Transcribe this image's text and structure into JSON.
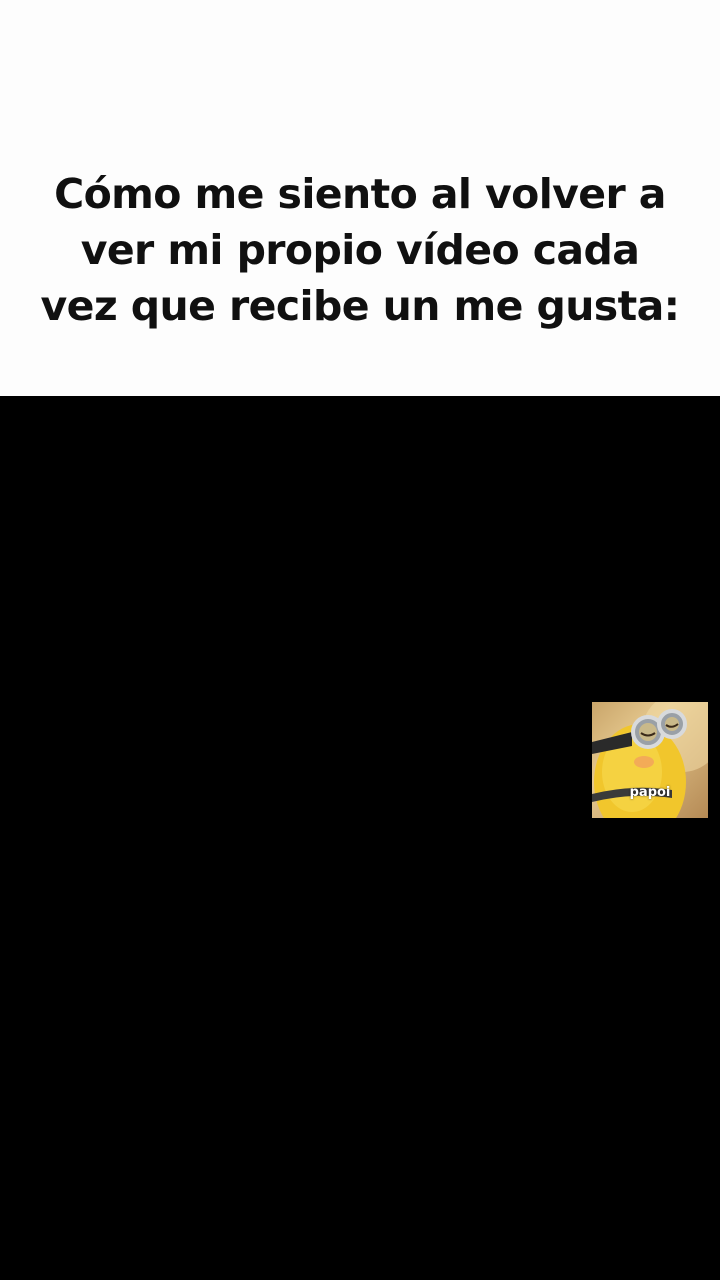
{
  "caption": {
    "text": "Cómo me siento al volver a ver mi propio vídeo cada vez que recibe un me gusta:"
  },
  "sticker": {
    "label": "papoi",
    "icon": "minion-icon"
  },
  "colors": {
    "caption_background": "#fdfdfd",
    "caption_text": "#101010",
    "video_background": "#000000"
  }
}
